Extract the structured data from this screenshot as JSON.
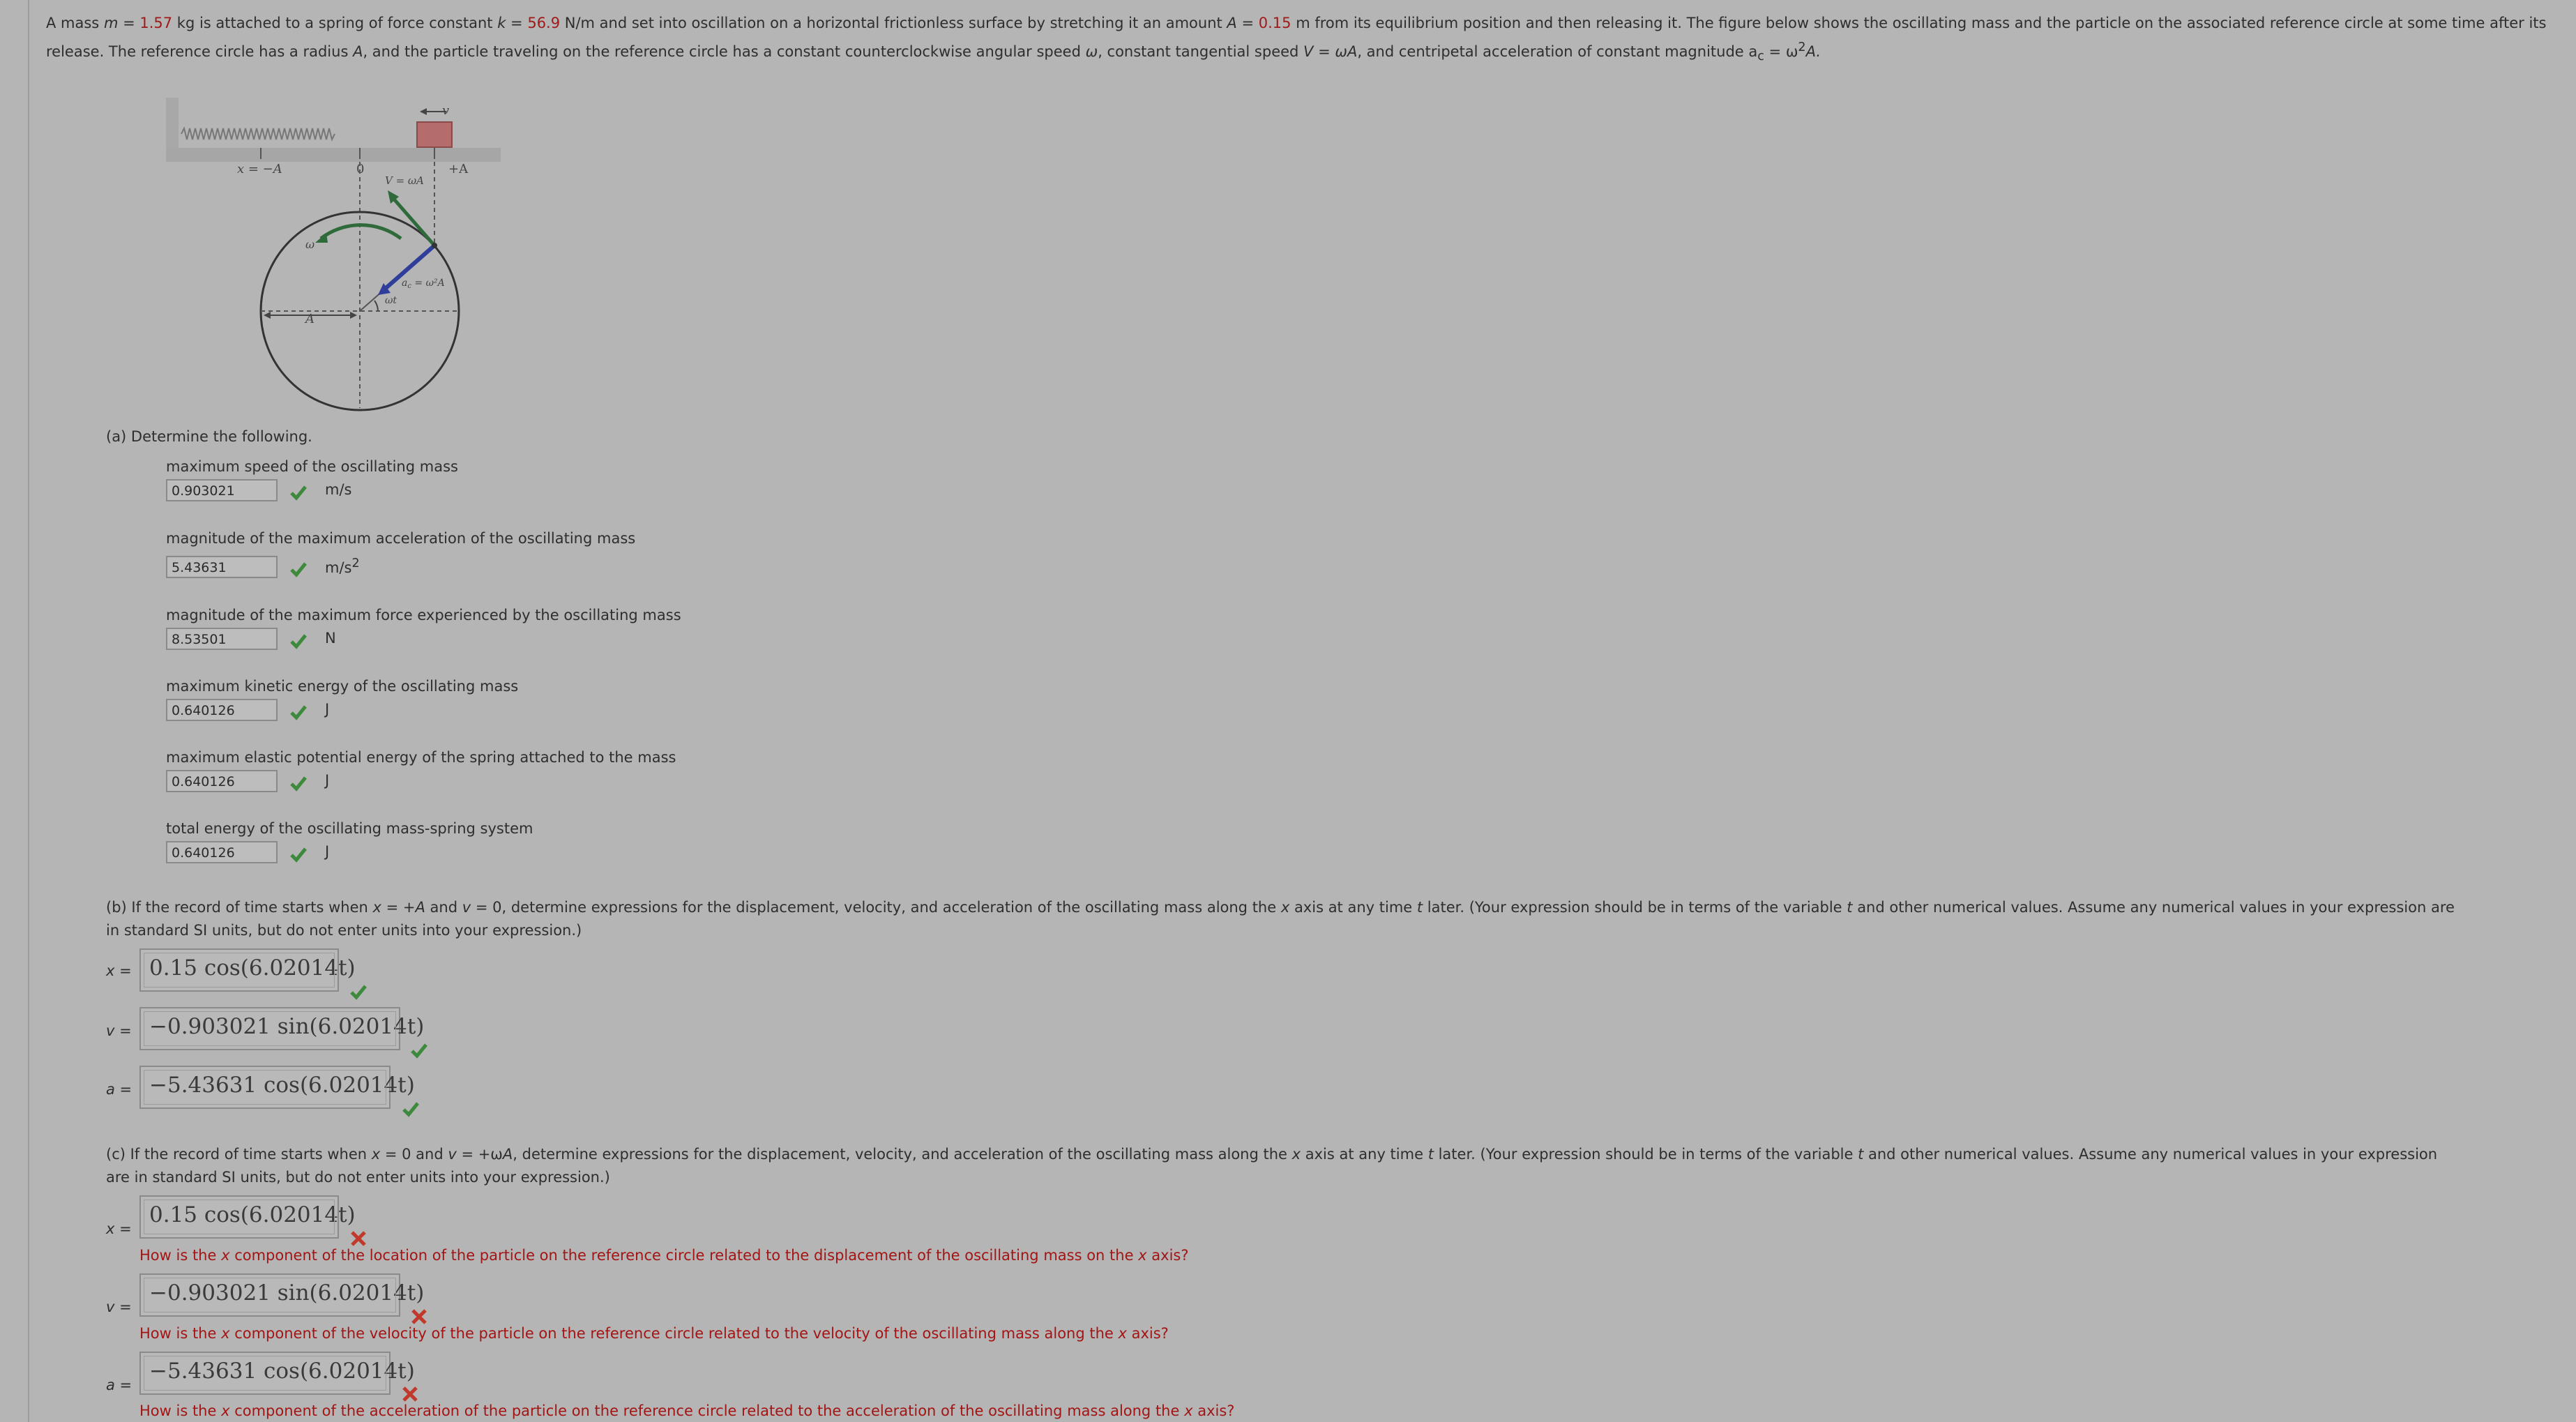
{
  "intro": {
    "p1": "A mass ",
    "m_sym": "m",
    "p2": " = ",
    "m_val": "1.57",
    "p3": " kg is attached to a spring of force constant ",
    "k_sym": "k",
    "p4": " = ",
    "k_val": "56.9",
    "p5": " N/m and set into oscillation on a horizontal frictionless surface by stretching it an amount ",
    "A_sym": "A",
    "p6": " = ",
    "A_val": "0.15",
    "p7": " m from its equilibrium position and then releasing it. The figure below shows the oscillating mass and the particle on the associated reference circle at some time after its release. The reference circle has a radius ",
    "p8": "A",
    "p9": ", and the particle traveling on the reference circle has a constant counterclockwise angular speed ",
    "p10": "ω",
    "p11": ", constant tangential speed ",
    "p12": "V = ωA",
    "p13": ", and centripetal acceleration of constant magnitude a",
    "p14": "c",
    "p15": " = ω",
    "p16": "2",
    "p17": "A."
  },
  "figure": {
    "label_v": "v",
    "label_xnegA": "x = −A",
    "label_zero": "0",
    "label_posA": "+A",
    "label_V": "V = ωA",
    "label_omega": "ω",
    "label_ac": "a",
    "label_ac_sub": "c",
    "label_ac_rest": " = ω²A",
    "label_omega_t": "ωt",
    "label_A": "A"
  },
  "partA": {
    "heading": "(a) Determine the following.",
    "items": [
      {
        "question": "maximum speed of the oscillating mass",
        "value": "0.903021",
        "unit": "m/s"
      },
      {
        "question": "magnitude of the maximum acceleration of the oscillating mass",
        "value": "5.43631",
        "unit": "m/s",
        "unit_sup": "2"
      },
      {
        "question": "magnitude of the maximum force experienced by the oscillating mass",
        "value": "8.53501",
        "unit": "N"
      },
      {
        "question": "maximum kinetic energy of the oscillating mass",
        "value": "0.640126",
        "unit": "J"
      },
      {
        "question": "maximum elastic potential energy of the spring attached to the mass",
        "value": "0.640126",
        "unit": "J"
      },
      {
        "question": "total energy of the oscillating mass-spring system",
        "value": "0.640126",
        "unit": "J"
      }
    ]
  },
  "partB": {
    "text1": "(b) If the record of time starts when ",
    "text2": "x",
    "text3": " = +",
    "text4": "A",
    "text5": " and ",
    "text6": "v",
    "text7": " = 0, determine expressions for the displacement, velocity, and acceleration of the oscillating mass along the ",
    "text8": "x",
    "text9": " axis at any time ",
    "text10": "t",
    "text11": " later. (Your expression should be in terms of the variable ",
    "text12": "t",
    "text13": " and other numerical values. Assume any numerical values in your expression are",
    "text14": "in standard SI units, but do not enter units into your expression.)",
    "x_label": "x =",
    "v_label": "v =",
    "a_label": "a =",
    "x_expr": "0.15 cos(6.02014t)",
    "v_expr": "−0.903021 sin(6.02014t)",
    "a_expr": "−5.43631 cos(6.02014t)"
  },
  "partC": {
    "text1": "(c) If the record of time starts when ",
    "text2": "x",
    "text3": " = 0 and ",
    "text4": "v",
    "text5": " = +ω",
    "text6": "A",
    "text7": ", determine expressions for the displacement, velocity, and acceleration of the oscillating mass along the ",
    "text8": "x",
    "text9": " axis at any time ",
    "text10": "t",
    "text11": " later. (Your expression should be in terms of the variable ",
    "text12": "t",
    "text13": " and other numerical values. Assume any numerical values in your expression",
    "text14": "are in standard SI units, but do not enter units into your expression.)",
    "x_label": "x =",
    "v_label": "v =",
    "a_label": "a =",
    "x_expr": "0.15 cos(6.02014t)",
    "v_expr": "−0.903021 sin(6.02014t)",
    "a_expr": "−5.43631 cos(6.02014t)",
    "x_hint_a": "How is the ",
    "x_hint_b": "x",
    "x_hint_c": " component of the location of the particle on the reference circle related to the displacement of the oscillating mass on the ",
    "x_hint_d": "x",
    "x_hint_e": " axis?",
    "v_hint_a": "How is the ",
    "v_hint_b": "x",
    "v_hint_c": " component of the velocity of the particle on the reference circle related to the velocity of the oscillating mass along the ",
    "v_hint_d": "x",
    "v_hint_e": " axis?",
    "a_hint_a": "How is the ",
    "a_hint_b": "x",
    "a_hint_c": " component of the acceleration of the particle on the reference circle related to the acceleration of the oscillating mass along the ",
    "a_hint_d": "x",
    "a_hint_e": " axis?"
  },
  "colors": {
    "check": "#3d8a3d",
    "wrong": "#c0392b",
    "given": "#a01a1a",
    "hint": "#a31515"
  }
}
